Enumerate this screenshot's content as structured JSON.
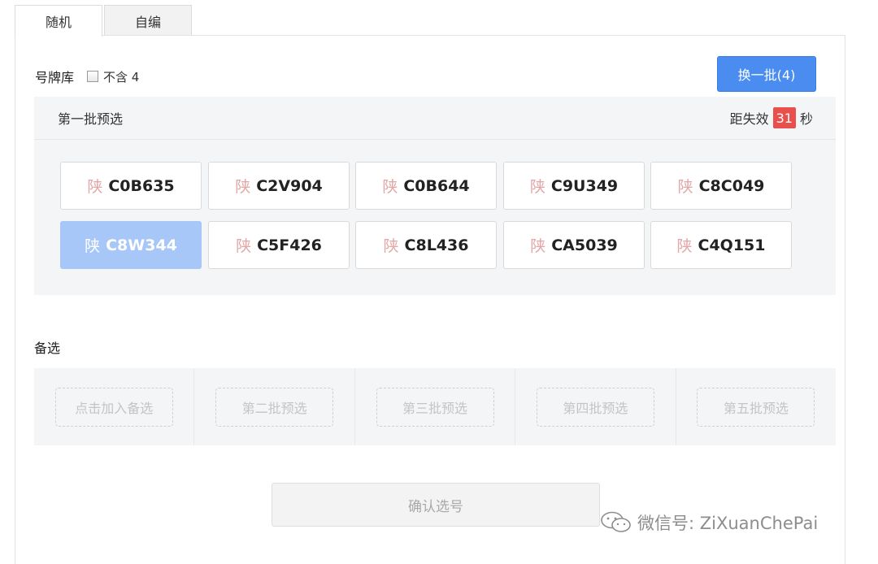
{
  "tabs": [
    {
      "label": "随机",
      "active": true
    },
    {
      "label": "自编",
      "active": false
    }
  ],
  "pool": {
    "label": "号牌库",
    "exclude_four_label": "不含 4",
    "exclude_four_checked": false
  },
  "refresh_button": "换一批(4)",
  "batch": {
    "title": "第一批预选",
    "countdown_prefix": "距失效",
    "countdown_value": "31",
    "countdown_unit": "秒",
    "plates": [
      {
        "prov": "陕",
        "num": "C0B635",
        "selected": false
      },
      {
        "prov": "陕",
        "num": "C2V904",
        "selected": false
      },
      {
        "prov": "陕",
        "num": "C0B644",
        "selected": false
      },
      {
        "prov": "陕",
        "num": "C9U349",
        "selected": false
      },
      {
        "prov": "陕",
        "num": "C8C049",
        "selected": false
      },
      {
        "prov": "陕",
        "num": "C8W344",
        "selected": true
      },
      {
        "prov": "陕",
        "num": "C5F426",
        "selected": false
      },
      {
        "prov": "陕",
        "num": "C8L436",
        "selected": false
      },
      {
        "prov": "陕",
        "num": "CA5039",
        "selected": false
      },
      {
        "prov": "陕",
        "num": "C4Q151",
        "selected": false
      }
    ]
  },
  "alternates": {
    "label": "备选",
    "slots": [
      "点击加入备选",
      "第二批预选",
      "第三批预选",
      "第四批预选",
      "第五批预选"
    ]
  },
  "confirm_button": "确认选号",
  "watermark": "微信号: ZiXuanChePai",
  "colors": {
    "accent": "#4a8cf0",
    "selected_plate": "#a6c7f8",
    "countdown_badge": "#e9504c"
  }
}
